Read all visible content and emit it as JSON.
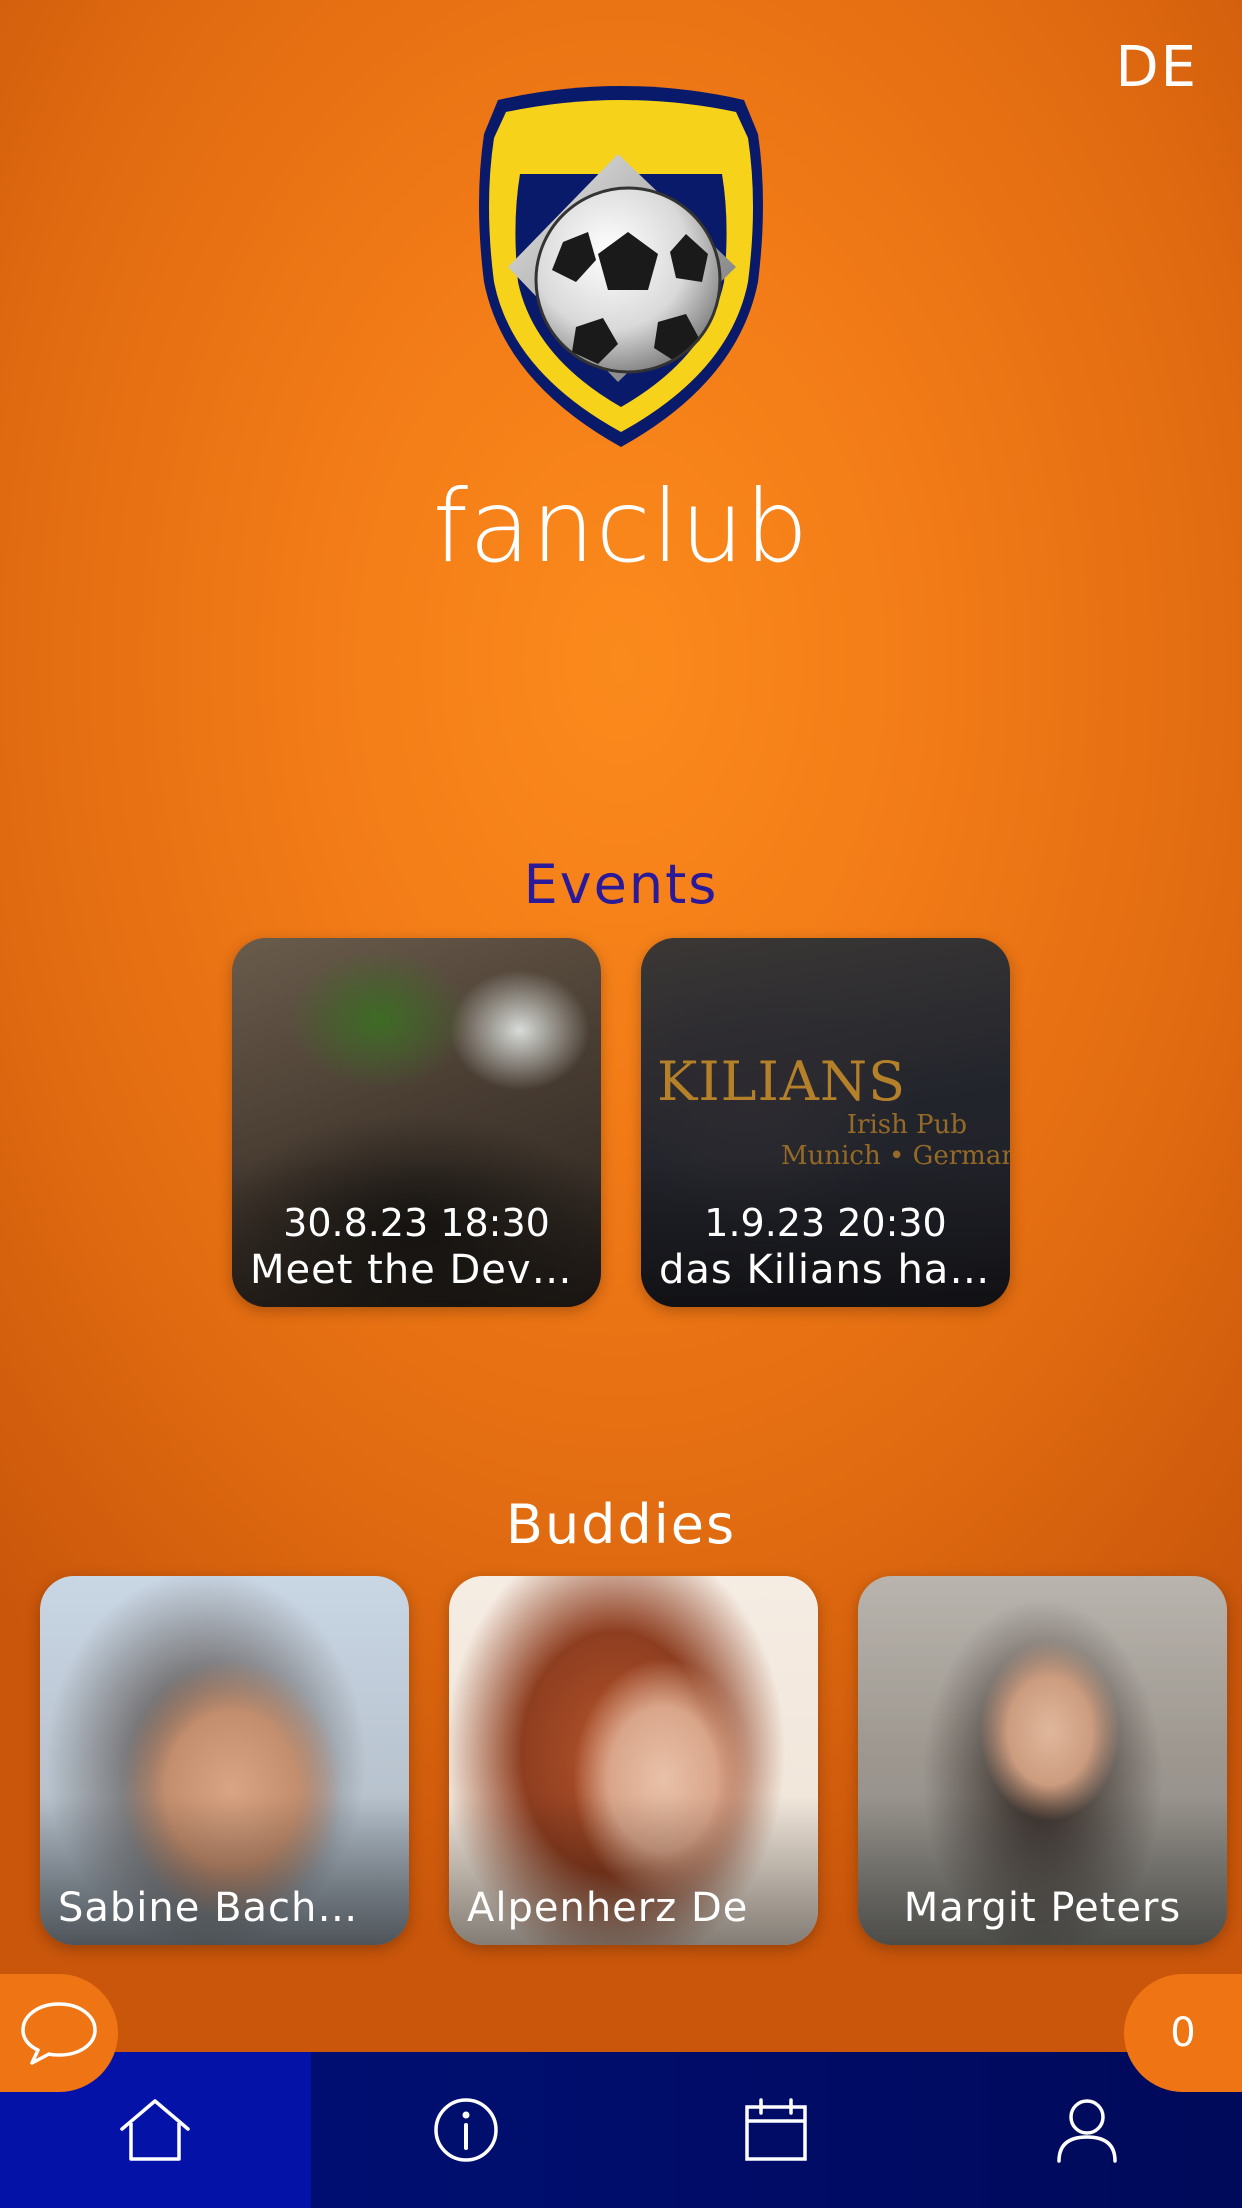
{
  "header": {
    "language": "DE",
    "app_title": "fanclub"
  },
  "events": {
    "title": "Events",
    "items": [
      {
        "date": "30.8.23 18:30",
        "title": "Meet the Devs ..."
      },
      {
        "date": "1.9.23 20:30",
        "title": "das Kilians hat..."
      }
    ],
    "sign_text": "KILIANS",
    "sign_subtext": "Irish Pub\nMunich • Germany"
  },
  "buddies": {
    "title": "Buddies",
    "items": [
      {
        "name": "Sabine Bachm..."
      },
      {
        "name": "Alpenherz De"
      },
      {
        "name": "Margit Peters"
      }
    ]
  },
  "floating": {
    "chat_icon": "chat-bubble-icon",
    "count": "0"
  },
  "tabbar": {
    "active": "home",
    "items": [
      {
        "id": "home",
        "icon": "home-icon"
      },
      {
        "id": "info",
        "icon": "info-icon"
      },
      {
        "id": "calendar",
        "icon": "calendar-icon"
      },
      {
        "id": "profile",
        "icon": "user-icon"
      }
    ]
  },
  "colors": {
    "background": "#f27b17",
    "events_title": "#2a1a9a",
    "tabbar": "#000a5a",
    "tab_active": "#0412a8",
    "fab": "#ef7413",
    "badge_yellow": "#f7d21a",
    "badge_navy": "#0a1a6b"
  }
}
